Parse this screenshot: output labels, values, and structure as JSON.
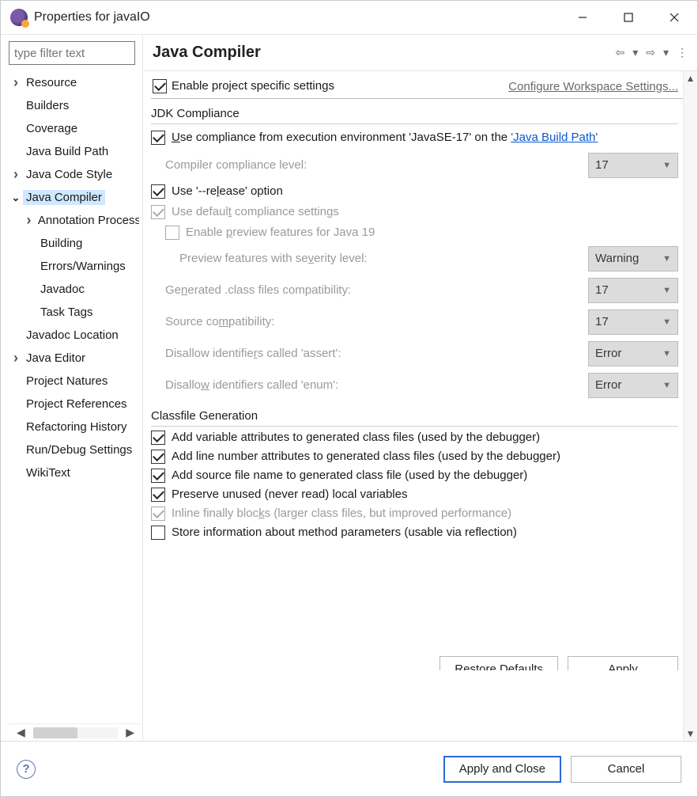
{
  "window": {
    "title": "Properties for javaIO"
  },
  "sidebar": {
    "filter_placeholder": "type filter text",
    "items": [
      {
        "label": "Resource",
        "lvl": 0,
        "tw": ">"
      },
      {
        "label": "Builders",
        "lvl": 0,
        "tw": ""
      },
      {
        "label": "Coverage",
        "lvl": 0,
        "tw": ""
      },
      {
        "label": "Java Build Path",
        "lvl": 0,
        "tw": ""
      },
      {
        "label": "Java Code Style",
        "lvl": 0,
        "tw": ">"
      },
      {
        "label": "Java Compiler",
        "lvl": 0,
        "tw": "v",
        "selected": true
      },
      {
        "label": "Annotation Processing",
        "lvl": 1,
        "tw": ">"
      },
      {
        "label": "Building",
        "lvl": 1,
        "tw": ""
      },
      {
        "label": "Errors/Warnings",
        "lvl": 1,
        "tw": ""
      },
      {
        "label": "Javadoc",
        "lvl": 1,
        "tw": ""
      },
      {
        "label": "Task Tags",
        "lvl": 1,
        "tw": ""
      },
      {
        "label": "Javadoc Location",
        "lvl": 0,
        "tw": ""
      },
      {
        "label": "Java Editor",
        "lvl": 0,
        "tw": ">"
      },
      {
        "label": "Project Natures",
        "lvl": 0,
        "tw": ""
      },
      {
        "label": "Project References",
        "lvl": 0,
        "tw": ""
      },
      {
        "label": "Refactoring History",
        "lvl": 0,
        "tw": ""
      },
      {
        "label": "Run/Debug Settings",
        "lvl": 0,
        "tw": ""
      },
      {
        "label": "WikiText",
        "lvl": 0,
        "tw": ""
      }
    ]
  },
  "main": {
    "title": "Java Compiler",
    "enable_project_label": "Enable project specific settings",
    "configure_link": "Configure Workspace Settings...",
    "jdk_section_title": "JDK Compliance",
    "use_exec_env_pre": "se compliance from execution environment 'JavaSE-17' on the ",
    "use_exec_env_link": "'Java Build Path'",
    "compliance_level_label": "Compiler compliance level:",
    "compliance_level_value": "17",
    "use_release_pre": "Use '--re",
    "use_release_post": "ease' option",
    "use_default_pre": "Use defaul",
    "use_default_post": " compliance settings",
    "enable_preview_pre": "Enable ",
    "enable_preview_post": "review features for Java 19",
    "preview_severity_pre": "Preview features with se",
    "preview_severity_post": "erity level:",
    "preview_severity_value": "Warning",
    "generated_class_pre": "Ge",
    "generated_class_post": "erated .class files compatibility:",
    "generated_class_value": "17",
    "source_compat_pre": "Source co",
    "source_compat_post": "patibility:",
    "source_compat_value": "17",
    "disallow_assert_pre": "Disallow identifie",
    "disallow_assert_post": "s called 'assert':",
    "disallow_assert_value": "Error",
    "disallow_enum_pre": "Disallo",
    "disallow_enum_post": " identifiers called 'enum':",
    "disallow_enum_value": "Error",
    "classfile_section_title": "Classfile Generation",
    "cf_var": "Add variable attributes to generated class files (used by the debugger)",
    "cf_line": "Add line number attributes to generated class files (used by the debugger)",
    "cf_src": "Add source file name to generated class file (used by the debugger)",
    "cf_preserve": "Preserve unused (never read) local variables",
    "cf_inline_pre": "Inline finally bloc",
    "cf_inline_post": "s (larger class files, but improved performance)",
    "cf_store": "Store information about method parameters (usable via reflection)",
    "restore_defaults": "Restore Defaults",
    "apply": "Apply"
  },
  "buttons": {
    "apply_close": "Apply and Close",
    "cancel": "Cancel"
  }
}
